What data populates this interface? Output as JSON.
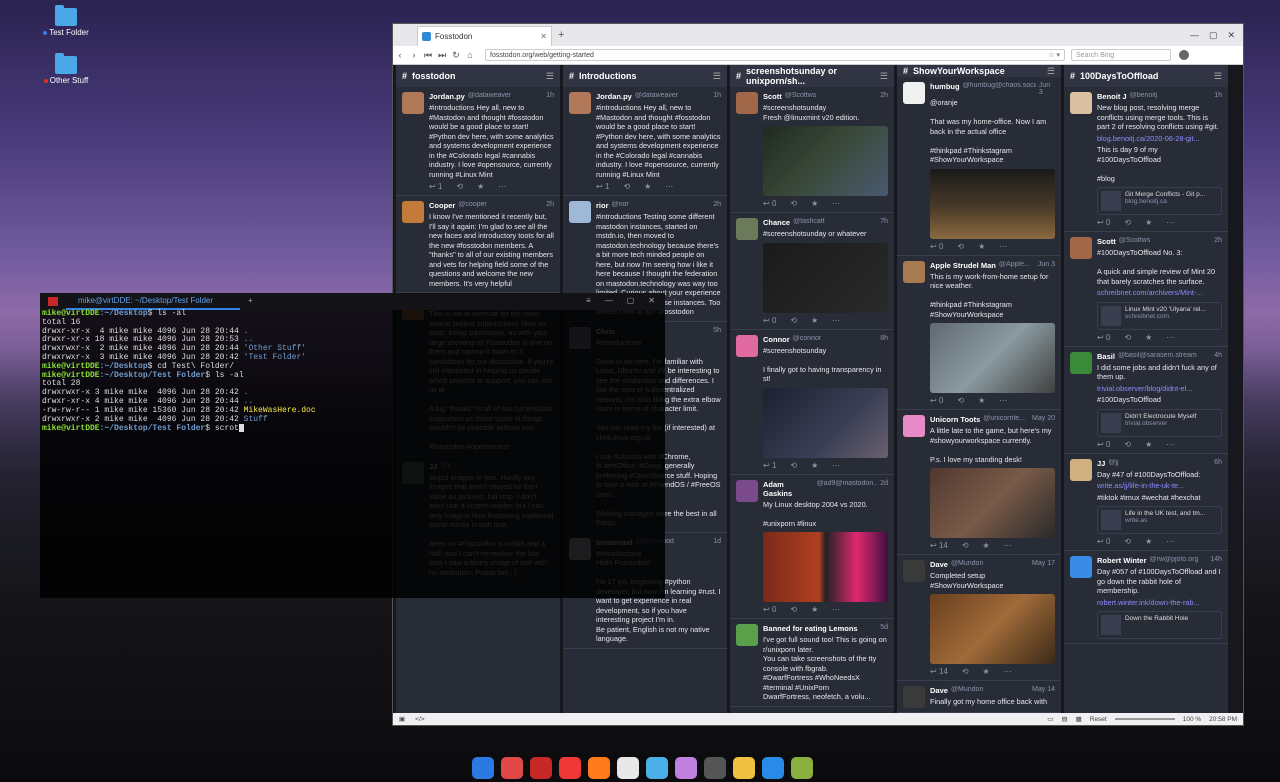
{
  "desktop": {
    "icons": [
      {
        "label": "Test Folder",
        "dot": "#3b7de8"
      },
      {
        "label": "Other Stuff",
        "dot": "#e03030"
      }
    ]
  },
  "browser": {
    "tab_title": "Fosstodon",
    "url": "fosstodon.org/web/getting-started",
    "search_placeholder": "Search Bing",
    "status": {
      "reset": "Reset",
      "zoom": "100 %",
      "time": "20:58 PM"
    }
  },
  "columns": [
    {
      "title": "fosstodon",
      "toots": [
        {
          "name": "Jordan.py",
          "handle": "@dataweaver",
          "time": "1h",
          "avatar": "#b07858",
          "text": "#introductions Hey all, new to #Mastodon and thought #fosstodon would be a good place to start! #Python dev here, with some analytics and systems development experience in the #Colorado legal #cannabis industry. I love #opensource, currently running #Linux Mint",
          "reply": "1"
        },
        {
          "name": "Cooper",
          "handle": "@cooper",
          "time": "2h",
          "avatar": "#c47a3a",
          "text": "I know I've mentioned it recently but, I'll say it again: I'm glad to see all the new faces and introductory toots for all the new #fosstodon members. A \"thanks\" to all of our existing members and vets for helping field some of the questions and welcome the new members. It's very helpful"
        },
        {
          "name": "Cooper",
          "handle": "@cooper",
          "time": "",
          "avatar": "#c47a3a",
          "text": "This is not to overuse for the open source project submissions! Now on topic: being submissive, as with your large showing on Fosstodon is one on them and narrow it down to 3 candidates for our discussion. If you're still interested in helping us decide which projects to support, you can join us at\n\nA big \"thanks\" to all of our current/past supporters as these types of things wouldn't be possible without you.\n\n#fosstodon #opensource"
        },
        {
          "name": "JJ",
          "handle": "@jj",
          "time": "",
          "avatar": "#6a8a6a",
          "text": "stupid images or text. Hardly any images that aren't shared for their value as pictures, full stop. I don't even use a screen-reader, but I can only imagine how frustrating traditional social media is with one.\n\nBeen on #Fosstodon a month and a half, and I can't remember the last time I saw a blurry image of text with no attribution. Praise be! ; )"
        }
      ]
    },
    {
      "title": "Introductions",
      "toots": [
        {
          "name": "Jordan.py",
          "handle": "@dataweaver",
          "time": "1h",
          "avatar": "#b07858",
          "text": "#introductions Hey all, new to #Mastodon and thought #fosstodon would be a good place to start! #Python dev here, with some analytics and systems development experience in the #Colorado legal #cannabis industry. I love #opensource, currently running #Linux Mint",
          "reply": "1"
        },
        {
          "name": "rior",
          "handle": "@rior",
          "time": "2h",
          "avatar": "#a0b8d8",
          "text": "#introductions Testing some different mastodon instances, started on mstdn.io, then moved to mastodon.technology because there's a bit more tech minded people on here, but now I'm seeing how i like it here because I thought the federation on mastodon.technology was way too limited. Curious about your experience with federation or these instances. Too limited? Not at all? #fosstodon"
        },
        {
          "name": "Chris",
          "handle": "",
          "time": "5h",
          "avatar": "#8888aa",
          "text": "#introductions\n\nGood to be here, I'm familiar with Linux, Ubuntu and it'll be interesting to see the similarities and differences. I like the idea of a decentralized network, I'm also liking the extra elbow room in terms of character limit.\n\nYou can read my bio (if interested) at chris.linux.org.uk\n\nI use #Ubuntu with #Chrome, #LibreOffice, #Gimp, generally preferring #OpenSource stuff. Hoping to take a look at #FriendOS / #FreeOS soon.\n\nWalking manages were the best in all things."
        },
        {
          "name": "termoniod",
          "handle": "@termoniod",
          "time": "1d",
          "avatar": "#c8c8d0",
          "text": "#introductions\nHello Fosstodon!\n\nI'm 17 y.o. beginning #python developer, but now i'm learning #rust. I want to get experience in real development, so if you have interesting project I'm in.\nBe patient, English is not my native language."
        }
      ]
    },
    {
      "title": "screenshotsunday or unixporn/sh...",
      "toots": [
        {
          "name": "Scott",
          "handle": "@Scottws",
          "time": "2h",
          "avatar": "#a06848",
          "text": "#screenshotsunday\nFresh @linuxmint v20 edition.",
          "media": "linear-gradient(135deg,#202a20,#3a4a3a 50%,#4a5a70)",
          "reply": "0"
        },
        {
          "name": "Chance",
          "handle": "@tashcatt",
          "time": "7h",
          "avatar": "#6a7a5a",
          "text": "#screenshotsunday or whatever",
          "media": "linear-gradient(135deg,#1a1a1a,#2a2a2a)",
          "reply": "0"
        },
        {
          "name": "Connor",
          "handle": "@connor",
          "time": "8h",
          "avatar": "#e06aa0",
          "text": "#screenshotsunday\n\nI finally got to having transparency in st!",
          "media": "linear-gradient(135deg,#1c2030,#3a3f55 60%,#6a6070)",
          "reply": "1"
        },
        {
          "name": "Adam Gaskins",
          "handle": "@ad9@mastodon...",
          "time": "2d",
          "avatar": "#7a4a8a",
          "text": "My Linux desktop 2004 vs 2020.\n\n#unixporn #linux",
          "media": "linear-gradient(90deg,#7a2a1a 0%,#b04020 45%,#222 50%,#e02870 75%,#401040 100%)",
          "reply": "0"
        },
        {
          "name": "Banned for eating Lemons",
          "handle": "",
          "time": "5d",
          "avatar": "#5aa04a",
          "text": "I've got full sound too! This is going on r/unixporn later.\nYou can take screenshots of the tty console with fbgrab.\n#DwarfFortress #WhoNeedsX #terminal #UnixPorn\nDwarfFortress, neofetch, a volu..."
        }
      ]
    },
    {
      "title": "ShowYourWorkspace",
      "toots": [
        {
          "name": "humbug",
          "handle": "@humbug@chaos.social",
          "time": "Jun 3",
          "avatar": "#f0f0f0",
          "text": "@oranje\n\nThat was my home-office. Now I am back in the actual office\n\n#thinkpad #Thinkstagram\n#ShowYourWorkspace",
          "media": "linear-gradient(180deg,#1a1a1a,#4a3a28 55%,#8a6a40)",
          "reply": "0"
        },
        {
          "name": "Apple Strudel Man",
          "handle": "@Apple...",
          "time": "Jun 3",
          "avatar": "#a87a50",
          "text": "This is my work-from-home setup for nice weather.\n\n#thinkpad #Thinkstagram\n#ShowYourWorkspace",
          "media": "linear-gradient(135deg,#606a70,#8a9aa0 50%,#404040)",
          "reply": "0"
        },
        {
          "name": "Unicorn Toots",
          "handle": "@unicornfe...",
          "time": "May 20",
          "avatar": "#e88ac8",
          "text": "A little late to the game, but here's my #showyourworkspace currently.\n\nP.s. I love my standing desk!",
          "media": "linear-gradient(135deg,#503830,#7a5a48 50%,#2a2a2a)",
          "reply": "14"
        },
        {
          "name": "Dave",
          "handle": "@Mundon",
          "time": "May 17",
          "avatar": "#3a3a3a",
          "text": "Completed setup\n#ShowYourWorkspace",
          "media": "linear-gradient(135deg,#6a4020,#a06a38 50%,#3a2a1a)",
          "reply": "14"
        },
        {
          "name": "Dave",
          "handle": "@Mundon",
          "time": "May 14",
          "avatar": "#3a3a3a",
          "text": "Finally got my home office back with"
        }
      ]
    },
    {
      "title": "100DaysToOffload",
      "toots": [
        {
          "name": "Benoit J",
          "handle": "@benoitj",
          "time": "1h",
          "avatar": "#d8c0a0",
          "text": "New blog post, resolving merge conflicts using merge tools. This is part 2 of resolving conflicts using #git.",
          "link": "blog.benoitj.ca/2020-06-28-git...",
          "text2": "This is day 9 of my #100DaysToOffload\n\n#blog",
          "card": {
            "title": "Git Merge Conflicts - Git p...",
            "site": "blog.benoitj.ca"
          },
          "reply": "0"
        },
        {
          "name": "Scott",
          "handle": "@Scottws",
          "time": "2h",
          "avatar": "#a06848",
          "text": "#100DaysToOffload No. 3:\n\nA quick and simple review of Mint 20 that barely scratches the surface.",
          "link": "schreibnet.com/archivers/Mint-...",
          "card": {
            "title": "Linux Mint v20 'Ulyana' rel...",
            "site": "schreibnet.com"
          },
          "reply": "0"
        },
        {
          "name": "Basil",
          "handle": "@basil@sarasem.stream",
          "time": "4h",
          "avatar": "#3a8a3a",
          "text": "I did some jobs and didn't fuck any of them up.",
          "link": "trivial.observer/blog/didnt-el...",
          "text2": "#100DaysToOffload",
          "card": {
            "title": "Didn't Electrocute Myself",
            "site": "trivial.observer"
          },
          "reply": "0"
        },
        {
          "name": "JJ",
          "handle": "@jj",
          "time": "6h",
          "avatar": "#d0b080",
          "text": "Day #47 of #100DaysToOffload:",
          "link": "write.as/jj/life-in-the-uk-te...",
          "text2": "#tiktok #imux #wechat #hexchat",
          "card": {
            "title": "Life in the UK test, and tm...",
            "site": "write.as"
          },
          "reply": "0"
        },
        {
          "name": "Robert Winter",
          "handle": "@rw@pjoto.org",
          "time": "14h",
          "avatar": "#3a8ae8",
          "text": "Day #057 of #100DaysToOffload and I go down the rabbit hole of membership.",
          "link": "robert.winter.ink/down-the-rab...",
          "card": {
            "title": "Down the Rabbit Hole",
            "site": ""
          }
        }
      ]
    }
  ],
  "terminal": {
    "tab_title": "mike@virtDDE: ~/Desktop/Test Folder",
    "lines": [
      {
        "prompt": "mike@virtDDE",
        "path": ":~/Desktop",
        "cmd": "$ ls -al"
      },
      {
        "out": "total 16"
      },
      {
        "out": "drwxr-xr-x  4 mike mike 4096 Jun 28 20:44 ",
        "name": "."
      },
      {
        "out": "drwxr-xr-x 18 mike mike 4096 Jun 28 20:53 ",
        "name": ".."
      },
      {
        "out": "drwxrwxr-x  2 mike mike 4096 Jun 28 20:44 ",
        "name": "'Other Stuff'"
      },
      {
        "out": "drwxrwxr-x  3 mike mike 4096 Jun 28 20:42 ",
        "name": "'Test Folder'"
      },
      {
        "prompt": "mike@virtDDE",
        "path": ":~/Desktop",
        "cmd": "$ cd Test\\ Folder/"
      },
      {
        "prompt": "mike@virtDDE",
        "path": ":~/Desktop/Test Folder",
        "cmd": "$ ls -al"
      },
      {
        "out": "total 28"
      },
      {
        "out": "drwxrwxr-x 3 mike mike  4096 Jun 28 20:42 ",
        "name": "."
      },
      {
        "out": "drwxr-xr-x 4 mike mike  4096 Jun 28 20:44 ",
        "name": ".."
      },
      {
        "out": "-rw-rw-r-- 1 mike mike 15360 Jun 28 20:42 ",
        "file": "MikeWasHere.doc"
      },
      {
        "out": "drwxrwxr-x 2 mike mike  4096 Jun 28 20:42 ",
        "name": "Stuff"
      },
      {
        "prompt": "mike@virtDDE",
        "path": ":~/Desktop/Test Folder",
        "cmd": "$ scrot",
        "cursor": true
      }
    ]
  },
  "dock": {
    "icons": [
      {
        "name": "launcher-icon",
        "color": "#2a7ae2"
      },
      {
        "name": "screen-recorder-icon",
        "color": "#e04848"
      },
      {
        "name": "terminal-icon",
        "color": "#c62828"
      },
      {
        "name": "vivaldi-icon",
        "color": "#ef3939"
      },
      {
        "name": "firefox-icon",
        "color": "#ff7a1a"
      },
      {
        "name": "ghost-icon",
        "color": "#e8e8e8"
      },
      {
        "name": "app-store-icon",
        "color": "#4ab0e8"
      },
      {
        "name": "settings-icon",
        "color": "#c080e0"
      },
      {
        "name": "arrow-icon",
        "color": "#555555"
      },
      {
        "name": "clock-icon",
        "color": "#f0c040"
      },
      {
        "name": "power-icon",
        "color": "#2a8ae8"
      },
      {
        "name": "trash-icon",
        "color": "#8ab040"
      }
    ]
  }
}
